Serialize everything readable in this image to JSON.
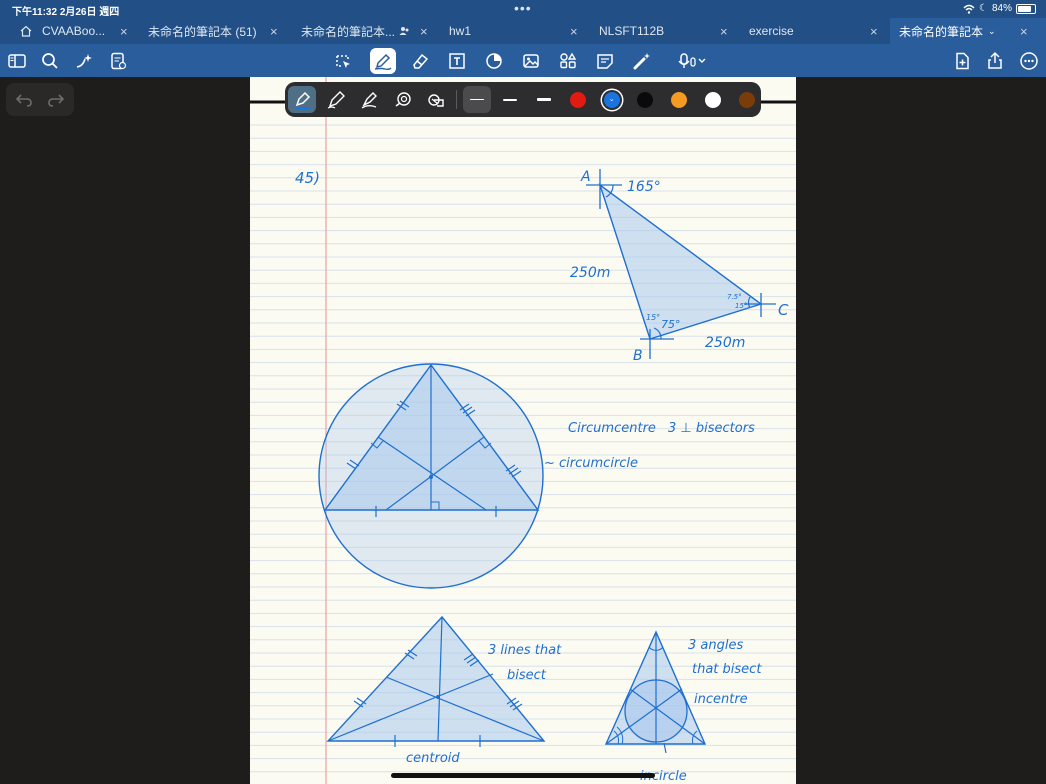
{
  "status": {
    "time": "下午11:32",
    "date": "2月26日 週四",
    "battery_percent": "84%",
    "battery_level": 0.84
  },
  "tabs": [
    {
      "label": "CVAABoo...",
      "active": false
    },
    {
      "label": "未命名的筆記本 (51)",
      "active": false
    },
    {
      "label": "未命名的筆記本...",
      "active": false
    },
    {
      "label": "hw1",
      "active": false
    },
    {
      "label": "NLSFT112B",
      "active": false
    },
    {
      "label": "exercise",
      "active": false
    },
    {
      "label": "未命名的筆記本",
      "active": true
    }
  ],
  "toolbar_left_icons": [
    "sidebar-icon",
    "search-icon",
    "sparkle-icon",
    "notes-settings-icon"
  ],
  "toolbar_center_icons": [
    "lasso-icon",
    "pen-icon",
    "eraser-icon",
    "textbox-icon",
    "shapes-icon",
    "image-icon",
    "elements-icon",
    "sticky-note-icon",
    "laser-pointer-icon",
    "microphone-icon"
  ],
  "toolbar_right_icons": [
    "add-page-icon",
    "share-icon",
    "more-icon"
  ],
  "pen_tools": [
    "fountain-pen-icon",
    "ball-pen-icon",
    "brush-pen-icon",
    "shape-recognition-icon",
    "tape-icon"
  ],
  "colors": {
    "swatches": [
      "#e21b12",
      "#1a74e0",
      "#0a0a0a",
      "#f39b23",
      "#ffffff",
      "#7a3d0a"
    ],
    "selected": "#1a74e0",
    "ink": "#1f6fd0",
    "fill": "#a8c8ec",
    "paper": "#fcfbf2",
    "margin_line": "#e8a3a5",
    "rule_line": "#d7e2ea"
  },
  "handwriting": {
    "q_no": "45)",
    "vertex_a": "A",
    "vertex_b": "B",
    "vertex_c": "C",
    "angle_165": "165°",
    "side_ab": "250m",
    "side_bc": "250m",
    "angle_75": "75°",
    "angle_15": "15°",
    "angle_7_5": "7.5°",
    "angle_b15": "15°",
    "circumcentre": "Circumcentre",
    "three_perp": "3 ⊥ bisectors",
    "circumcircle": "~ circumcircle",
    "three_lines": "3 lines that",
    "bisect": "bisect",
    "centroid": "centroid",
    "three_angles": "3 angles",
    "that_bisect": "that bisect",
    "incentre": "incentre",
    "incircle": "incircle"
  }
}
